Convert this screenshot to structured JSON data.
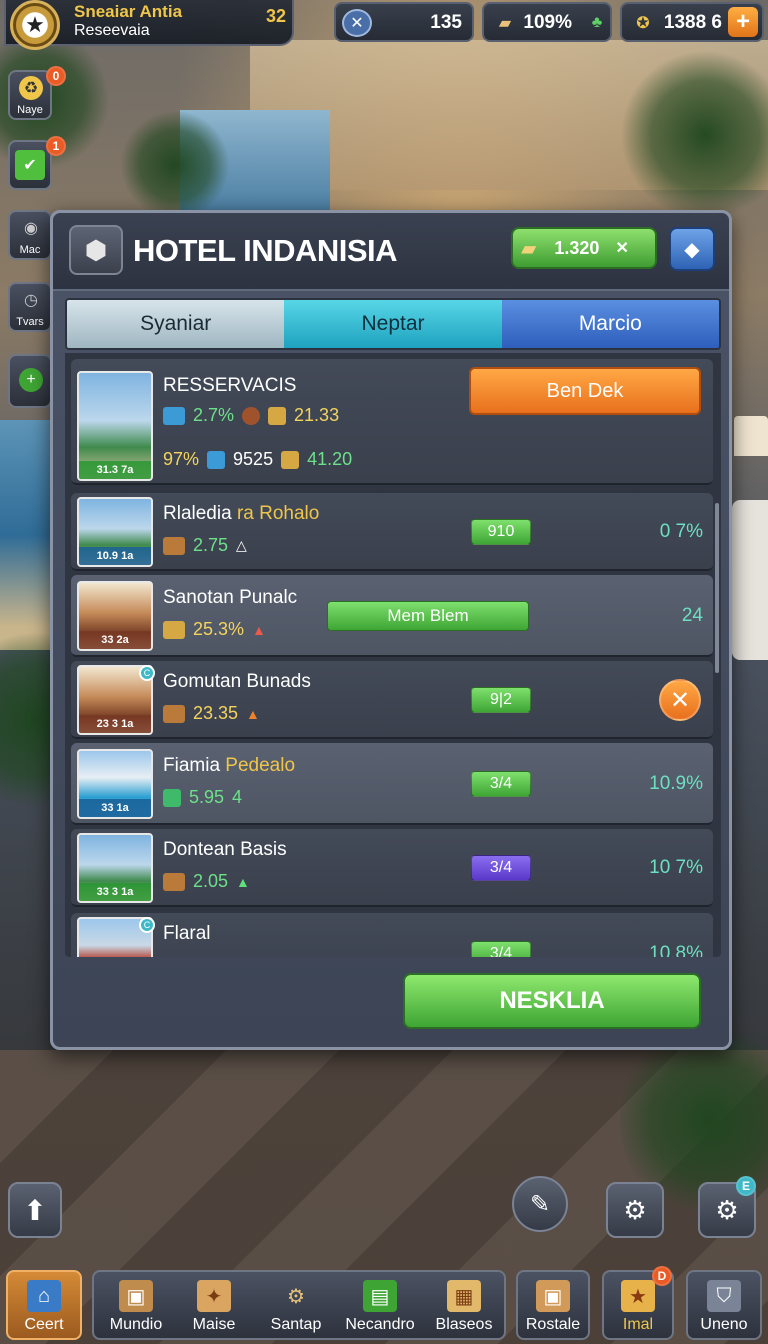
{
  "topbar": {
    "player_name": "Sneaiar Antia",
    "player_sub": "Resеevaia",
    "player_level": "32",
    "timer_value": "135",
    "cash_value": "109%",
    "gold_value": "1388 6",
    "plus_label": "+"
  },
  "side_buttons": [
    {
      "label": "Naye",
      "badge": "0"
    },
    {
      "label": "",
      "badge": "1"
    },
    {
      "label": "Mac",
      "badge": ""
    },
    {
      "label": "Tvars",
      "badge": ""
    }
  ],
  "dialog": {
    "title": "HOTEL INDANISIA",
    "cash": "1.320",
    "cash_x": "✕",
    "tabs": [
      "Syaniar",
      "Neptar",
      "Marcio"
    ],
    "rows": [
      {
        "name": "RESSERVACIS",
        "caption": "31.3 7a",
        "stat1": "2.7%",
        "stat2": "21.33",
        "stat3": "97%",
        "stat4": "9525",
        "stat5": "41.20",
        "button": "Ben Dek"
      },
      {
        "name_a": "Rlaledia",
        "name_b": "ra Rohalo",
        "caption": "10.9 1a",
        "stat": "2.75",
        "pill": "910",
        "right": "0 7%"
      },
      {
        "name": "Sanotan Punalc",
        "caption": "33 2a",
        "stat": "25.3%",
        "button": "Mem Blem",
        "right": "24"
      },
      {
        "name": "Gomutan Bunads",
        "caption": "23 3 1a",
        "stat": "23.35",
        "pill": "9|2"
      },
      {
        "name_a": "Fiamia",
        "name_b": "Pedealo",
        "caption": "33 1a",
        "stat": "5.95",
        "stat_b": "4",
        "pill": "3/4",
        "right": "10.9%"
      },
      {
        "name": "Dontean Basis",
        "caption": "33 3 1a",
        "stat": "2.05",
        "pill": "3/4",
        "right": "10 7%"
      },
      {
        "name": "Flaral",
        "pill": "3/4",
        "right": "10.8%"
      }
    ],
    "cta": "NESKLIA"
  },
  "bottom_nav": [
    {
      "label": "Ceert"
    },
    {
      "label": "Mundio"
    },
    {
      "label": "Maise"
    },
    {
      "label": "Santap"
    },
    {
      "label": "Necandro"
    },
    {
      "label": "Blaseos"
    },
    {
      "label": "Rostale"
    },
    {
      "label": "Imal",
      "badge": "D"
    },
    {
      "label": "Uneno"
    }
  ],
  "float_badge": "E",
  "colors": {
    "accent_green": "#4fbf3d",
    "accent_orange": "#f08a2a",
    "accent_blue": "#3a78d6",
    "gold": "#f0c64a"
  }
}
